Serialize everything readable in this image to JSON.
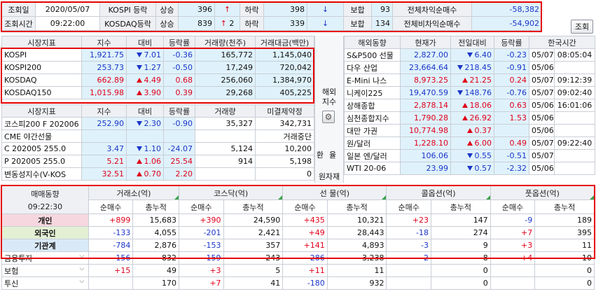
{
  "top": {
    "date_label": "조회일",
    "date_value": "2020/05/07",
    "time_label": "조회시간",
    "time_value": "09:22:00",
    "rows": [
      {
        "name": "KOSPI 등락",
        "up_label": "상승",
        "up_value": "396",
        "up_arrow": "↑",
        "down_label": "하락",
        "down_value": "398",
        "down_arrow": "↓",
        "flat_label": "보합",
        "flat_value": "93",
        "net_label": "전체차익순매수",
        "net_value": "-58,382"
      },
      {
        "name": "KOSDAQ등락",
        "up_label": "상승",
        "up_value": "839",
        "up_arrow": "↑",
        "up_count": "2",
        "down_label": "하락",
        "down_value": "339",
        "down_arrow": "↓",
        "flat_label": "보합",
        "flat_value": "134",
        "net_label": "전체비차익순매수",
        "net_value": "-54,902"
      }
    ],
    "query_button": "조회"
  },
  "index_table": {
    "headers": [
      "시장지표",
      "지수",
      "대비",
      "등락률",
      "거래량(천주)",
      "거래대금(백만)"
    ],
    "rows": [
      {
        "name": "KOSPI",
        "index": "1,921.75",
        "dir": "down",
        "change": "7.01",
        "rate": "-0.36",
        "volume": "165,772",
        "amount": "1,145,040"
      },
      {
        "name": "KOSPI200",
        "index": "253.73",
        "dir": "down",
        "change": "1.27",
        "rate": "-0.50",
        "volume": "17,249",
        "amount": "720,042"
      },
      {
        "name": "KOSDAQ",
        "index": "662.89",
        "dir": "up",
        "change": "4.49",
        "rate": "0.68",
        "volume": "256,060",
        "amount": "1,384,970"
      },
      {
        "name": "KOSDAQ150",
        "index": "1,015.98",
        "dir": "up",
        "change": "3.90",
        "rate": "0.39",
        "volume": "29,268",
        "amount": "405,225"
      }
    ]
  },
  "futures_table": {
    "headers": [
      "시장지표",
      "지수",
      "대비",
      "등락률",
      "거래량",
      "미결제약정"
    ],
    "rows": [
      {
        "name": "코스피200 F 202006",
        "index": "252.90",
        "dir": "down",
        "change": "2.30",
        "rate": "-0.90",
        "volume": "35,327",
        "amount": "342,731"
      },
      {
        "name": "CME 야간선물",
        "index": "",
        "dir": "",
        "change": "",
        "rate": "",
        "volume": "",
        "amount": "거래중단"
      },
      {
        "name": "C 202005 255.0",
        "index": "3.47",
        "dir": "down",
        "change": "1.10",
        "rate": "-24.07",
        "volume": "5,124",
        "amount": "10,200"
      },
      {
        "name": "P 202005 255.0",
        "index": "5.21",
        "dir": "up",
        "change": "1.06",
        "rate": "25.54",
        "volume": "914",
        "amount": "5,198"
      },
      {
        "name": "변동성지수(V-KOS",
        "index": "32.51",
        "dir": "up",
        "change": "0.70",
        "rate": "2.20",
        "volume": "",
        "amount": "0"
      }
    ]
  },
  "side_labels": {
    "overseas_line1": "해외",
    "overseas_line2": "지수",
    "fx_line1": "환",
    "fx_line2": "율",
    "commodity": "원자재"
  },
  "overseas_table": {
    "headers": [
      "해외동향",
      "현재가",
      "전일대비",
      "등락률",
      "한국시간"
    ],
    "rows": [
      {
        "name": "S&P500 선물",
        "price": "2,827.00",
        "dir": "down",
        "change": "6.40",
        "rate": "-0.23",
        "date": "05/07",
        "time": "08:05:04"
      },
      {
        "name": "다우 산업",
        "price": "23,664.64",
        "dir": "down",
        "change": "218.45",
        "rate": "-0.91",
        "date": "05/06",
        "time": ""
      },
      {
        "name": "E-Mini 나스",
        "price": "8,973.25",
        "dir": "up",
        "change": "21.25",
        "rate": "0.24",
        "date": "05/07",
        "time": "09:12:39"
      },
      {
        "name": "니케이225",
        "price": "19,470.59",
        "dir": "down",
        "change": "148.76",
        "rate": "-0.76",
        "date": "05/07",
        "time": "09:02:40"
      },
      {
        "name": "상해종합",
        "price": "2,878.14",
        "dir": "up",
        "change": "18.06",
        "rate": "0.63",
        "date": "05/06",
        "time": "16:01:06"
      },
      {
        "name": "심천종합지수",
        "price": "1,790.28",
        "dir": "up",
        "change": "26.92",
        "rate": "1.53",
        "date": "05/06",
        "time": ""
      },
      {
        "name": "대만 가권",
        "price": "10,774.98",
        "dir": "up",
        "change": "0.37",
        "rate": "",
        "date": "05/06",
        "time": ""
      },
      {
        "name": "원/달러",
        "price": "1,228.10",
        "dir": "up",
        "change": "6.00",
        "rate": "0.49",
        "date": "05/07",
        "time": "09:22:40"
      },
      {
        "name": "일본 엔/달러",
        "price": "106.06",
        "dir": "down",
        "change": "0.55",
        "rate": "-0.51",
        "date": "05/07",
        "time": ""
      },
      {
        "name": "WTI 20-06",
        "price": "23.99",
        "dir": "down",
        "change": "0.57",
        "rate": "-2.32",
        "date": "05/06",
        "time": ""
      }
    ]
  },
  "trading": {
    "title": "매매동향",
    "time": "09:22:30",
    "groups": [
      "거래소(억)",
      "코스닥(억)",
      "선 물(억)",
      "콜옵션(억)",
      "풋옵션(억)"
    ],
    "sub_net": "순매수",
    "sub_total": "총누적",
    "main_rows": [
      {
        "name": "개인",
        "values": [
          "+899",
          "15,683",
          "+390",
          "24,590",
          "+435",
          "10,321",
          "+23",
          "147",
          "-9",
          "189"
        ]
      },
      {
        "name": "외국인",
        "values": [
          "-133",
          "4,055",
          "-201",
          "2,421",
          "+49",
          "28,443",
          "-18",
          "274",
          "+7",
          "395"
        ]
      },
      {
        "name": "기관계",
        "values": [
          "-784",
          "2,876",
          "-153",
          "357",
          "+141",
          "4,893",
          "-3",
          "9",
          "+3",
          "11"
        ]
      }
    ],
    "sub_rows": [
      {
        "name": "금융투자",
        "values": [
          "-156",
          "832",
          "-159",
          "243",
          "-286",
          "3,238",
          "-2",
          "8",
          "+4",
          "10"
        ]
      },
      {
        "name": "보험",
        "values": [
          "+15",
          "49",
          "+3",
          "5",
          "+11",
          "11",
          "",
          "0",
          "",
          "0"
        ]
      },
      {
        "name": "투신",
        "values": [
          "",
          "170",
          "+7",
          "41",
          "-180",
          "932",
          "",
          "0",
          "",
          "0"
        ]
      }
    ]
  }
}
